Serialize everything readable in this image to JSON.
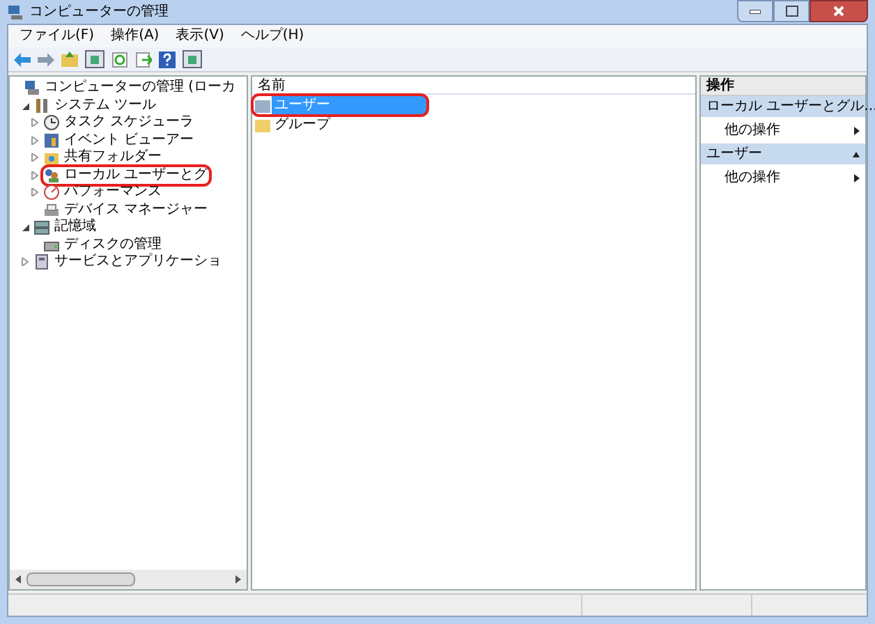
{
  "window": {
    "title": "コンピューターの管理"
  },
  "menu": [
    "ファイル(F)",
    "操作(A)",
    "表示(V)",
    "ヘルプ(H)"
  ],
  "tree": [
    {
      "label": "コンピューターの管理 (ローカ",
      "kind": "computer",
      "annotated": false,
      "children": [
        {
          "label": "システム ツール",
          "kind": "tools",
          "expandable": true,
          "expanded": true,
          "annotated": false,
          "children": [
            {
              "label": "タスク スケジューラ",
              "kind": "clock",
              "expandable": true,
              "expanded": false,
              "annotated": false
            },
            {
              "label": "イベント ビューアー",
              "kind": "event",
              "expandable": true,
              "expanded": false,
              "annotated": false
            },
            {
              "label": "共有フォルダー",
              "kind": "share",
              "expandable": true,
              "expanded": false,
              "annotated": false
            },
            {
              "label": "ローカル ユーザーとグ",
              "kind": "users",
              "expandable": true,
              "expanded": false,
              "annotated": true
            },
            {
              "label": "パフォーマンス",
              "kind": "perf",
              "expandable": true,
              "expanded": false,
              "annotated": false
            },
            {
              "label": "デバイス マネージャー",
              "kind": "device",
              "annotated": false
            }
          ]
        },
        {
          "label": "記憶域",
          "kind": "storage",
          "expandable": true,
          "expanded": true,
          "annotated": false,
          "children": [
            {
              "label": "ディスクの管理",
              "kind": "disk",
              "annotated": false
            }
          ]
        },
        {
          "label": "サービスとアプリケーショ",
          "kind": "services",
          "expandable": true,
          "expanded": false,
          "annotated": false
        }
      ]
    }
  ],
  "list": {
    "column": "名前",
    "items": [
      {
        "label": "ユーザー",
        "selected": true,
        "annotated": true
      },
      {
        "label": "グループ",
        "selected": false,
        "annotated": false
      }
    ]
  },
  "actions": {
    "title": "操作",
    "sections": [
      {
        "title": "ローカル ユーザーとグル...",
        "items": [
          "他の操作"
        ]
      },
      {
        "title": "ユーザー",
        "items": [
          "他の操作"
        ]
      }
    ]
  }
}
